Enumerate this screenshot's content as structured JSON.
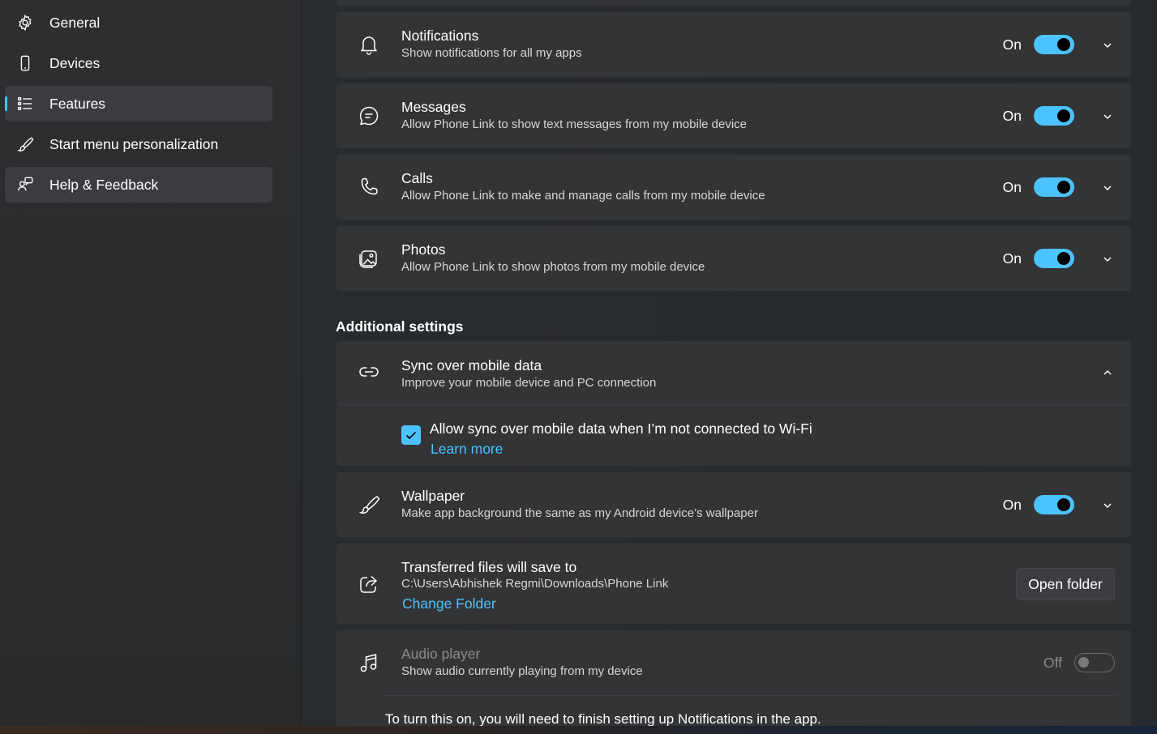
{
  "sidebar": {
    "items": [
      {
        "label": "General",
        "icon": "gear-icon"
      },
      {
        "label": "Devices",
        "icon": "phone-icon"
      },
      {
        "label": "Features",
        "icon": "list-icon",
        "selected": true
      },
      {
        "label": "Start menu personalization",
        "icon": "brush-icon"
      },
      {
        "label": "Help & Feedback",
        "icon": "help-people-icon"
      }
    ]
  },
  "features": [
    {
      "title": "Notifications",
      "desc": "Show notifications for all my apps",
      "state": "On",
      "icon": "bell-icon"
    },
    {
      "title": "Messages",
      "desc": "Allow Phone Link to show text messages from my mobile device",
      "state": "On",
      "icon": "chat-icon"
    },
    {
      "title": "Calls",
      "desc": "Allow Phone Link to make and manage calls from my mobile device",
      "state": "On",
      "icon": "phone-call-icon"
    },
    {
      "title": "Photos",
      "desc": "Allow Phone Link to show photos from my mobile device",
      "state": "On",
      "icon": "photos-icon"
    }
  ],
  "additional": {
    "heading": "Additional settings",
    "sync": {
      "title": "Sync over mobile data",
      "desc": "Improve your mobile device and PC connection",
      "checkbox_label": "Allow sync over mobile data when I’m not connected to Wi-Fi",
      "checked": true,
      "learn_more": "Learn more",
      "icon": "link-icon"
    },
    "wallpaper": {
      "title": "Wallpaper",
      "desc": "Make app background the same as my Android device’s wallpaper",
      "state": "On",
      "icon": "brush-icon"
    },
    "transfer": {
      "title": "Transferred files will save to",
      "path": "C:\\Users\\Abhishek Regmi\\Downloads\\Phone Link",
      "change_folder": "Change Folder",
      "open_folder": "Open folder",
      "icon": "share-icon"
    },
    "audio": {
      "title": "Audio player",
      "desc": "Show audio currently playing from my device",
      "state": "Off",
      "note": "To turn this on, you will need to finish setting up Notifications in the app.",
      "icon": "music-note-icon"
    }
  },
  "colors": {
    "accent": "#4cc2ff",
    "card": "#323436",
    "background": "#2a2c2e"
  }
}
